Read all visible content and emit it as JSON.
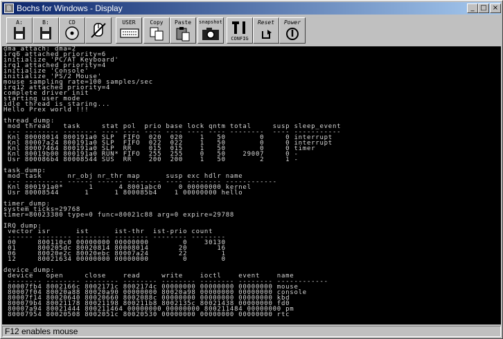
{
  "window": {
    "title": "Bochs for Windows - Display",
    "minimize_glyph": "_",
    "maximize_glyph": "□",
    "close_glyph": "×"
  },
  "toolbar": {
    "floppy_a_label": "A:",
    "floppy_b_label": "B:",
    "cdrom_label": "CD",
    "user_label": "USER",
    "copy_label": "Copy",
    "paste_label": "Paste",
    "snapshot_label": "snapshot",
    "config_label": "CONFIG",
    "reset_label": "Reset",
    "power_label": "Power"
  },
  "console": {
    "lines": [
      "dma_attach: dma=2",
      "irq6 attached priority=6",
      "initialize 'PC/AT Keyboard'",
      "irq1 attached priority=4",
      "initialize 'Console'",
      "initialize 'PS/2 Mouse'",
      "mouse sampling rate=100 samples/sec",
      "irq12 attached priority=4",
      "complete driver init",
      "starting user mode",
      "idle thread is staring...",
      "Hello Prex world !!!",
      "",
      "thread_dump:",
      " mod thread   task     stat pol  prio base lock qntm total     susp sleep_event",
      " --- -------- -------- ---- ---- ---- ---- ---- ---- --------  ---- -----------",
      " Knl 80008014 800191a0 SLP  FIFO  020  020    1   50        0     0 interrupt",
      " Knl 80007a24 800191a0 SLP  FIFO  022  022    1   50        0     0 interrupt",
      " Knl 80007464 800191a0 SLP  RR    015  015    1   50        0     0 timer",
      " Knl 80019b00 800191a0 RUN* FIFO  255  255    0   50    29007     0 -",
      " Usr 800086b4 80008544 SUS  RR    200  200    1   50        2     1 -",
      "",
      "task_dump:",
      " mod task      nr_obj nr_thr map      susp exc hdlr name",
      " --- --------- ------ ------ -------- ---- -------- ------------",
      " Knl 800191a0*      1      4 8001abc0    0 00000000 kernel",
      " Usr 80008544      1      1 800085b4    1 00000000 hello",
      "",
      "timer_dump:",
      "system_ticks=29768",
      "timer=80023380 type=0 func=80021c88 arg=0 expire=29788",
      "",
      "IRQ dump:",
      " vector isr      ist      ist-thr  ist-prio count",
      " ------ -------- -------- -------- -------- --------",
      " 00     800110c0 00000000 00000000        0    30130",
      " 01     800205dc 80020814 80008014       20       16",
      " 06     80020e2c 80020ebc 80007a24       22        1",
      " 12     80021634 00000000 00000000        0        0",
      "",
      "device_dump:",
      " device   open     close    read     write    ioctl    event    name",
      " -------- -------- -------- -------- -------- -------- -------- ------------",
      " 80007fb4 8002166c 8002171c 8002174c 00000000 00000000 00000000 mouse",
      " 80007f04 80020a88 80020a90 00000000 80020a98 00000000 00000000 console",
      " 80007f14 80020640 80020660 8002088c 00000000 00000000 00000000 kbd",
      " 800079b4 80021178 80021198 800211b8 8002135c 80021438 00000000 fd0",
      " 80007a94 80021444 800211464 00000000 00000000 800211484 00000000 pm",
      " 80007954 80020508 8002051c 80020530 00000000 00000000 00000000 rtc"
    ]
  },
  "status": {
    "text": "F12 enables mouse"
  }
}
